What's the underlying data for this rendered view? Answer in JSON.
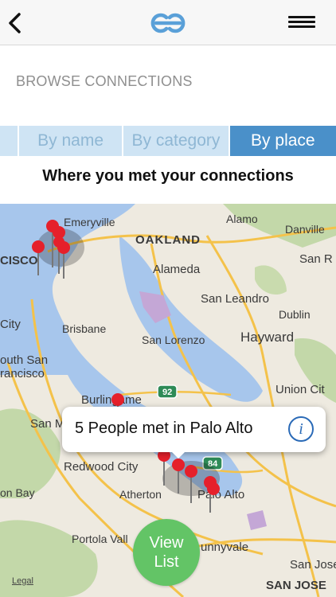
{
  "header": {
    "back_icon": "chevron-left-icon",
    "logo_icon": "link-logo-icon",
    "menu_icon": "hamburger-menu-icon"
  },
  "section_title": "BROWSE CONNECTIONS",
  "tabs": [
    {
      "label": "By name",
      "active": false
    },
    {
      "label": "By category",
      "active": false
    },
    {
      "label": "By place",
      "active": true
    }
  ],
  "map_heading": "Where you met your connections",
  "map": {
    "labels": [
      "Emeryville",
      "OAKLAND",
      "Alameda",
      "San Leandro",
      "Hayward",
      "San Lorenzo",
      "Brisbane",
      "Alamo",
      "Danville",
      "San R",
      "Dublin",
      "Union Cit",
      "CISCO",
      "City",
      "outh San",
      "rancisco",
      "Burlingame",
      "San M",
      "Redwood City",
      "Atherton",
      "Palo Alto",
      "on Bay",
      "Portola Vall",
      "unnyvale",
      "SAN JOSE",
      "San Jose"
    ],
    "highways": [
      "92",
      "84"
    ],
    "legal": "Legal"
  },
  "callout": {
    "text": "5 People met in Palo Alto",
    "info_label": "i"
  },
  "view_list": {
    "line1": "View",
    "line2": "List"
  },
  "colors": {
    "header_bg": "#f7f7f7",
    "tab_bg": "#cfe4f4",
    "tab_text": "#8fb7d4",
    "tab_active": "#4a90c9",
    "water": "#a7c6ec",
    "land": "#eeeae0",
    "park": "#b8d39b",
    "pin": "#e5202b",
    "view_list": "#63c466"
  }
}
